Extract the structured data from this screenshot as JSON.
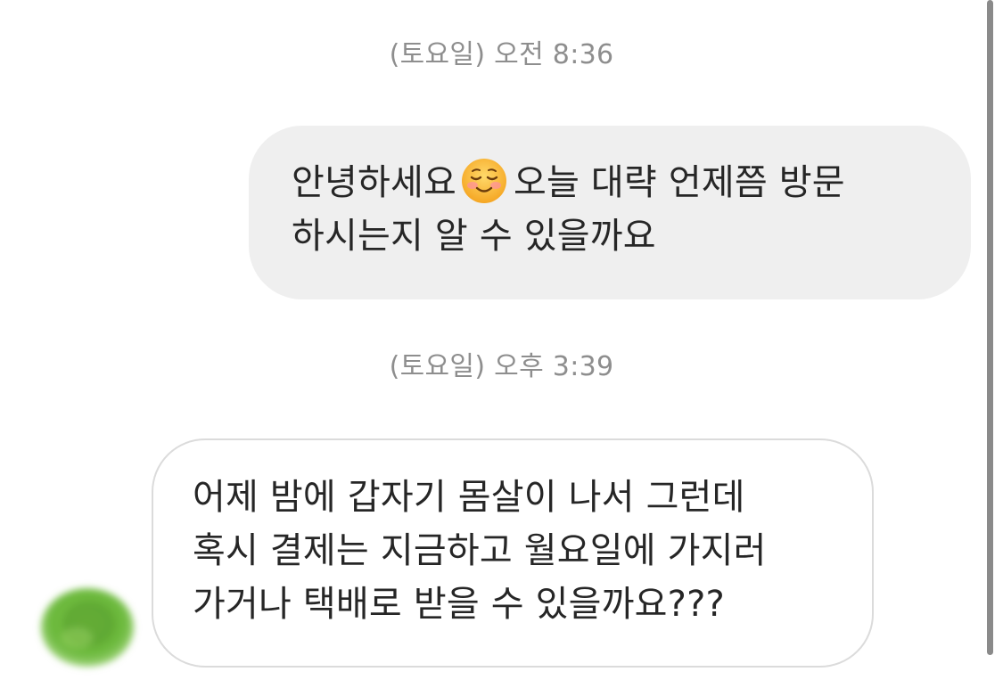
{
  "conversation": {
    "timestamps": [
      "(토요일) 오전 8:36",
      "(토요일) 오후 3:39"
    ],
    "messages": [
      {
        "direction": "outgoing",
        "lines": [
          [
            "안녕하세요",
            "오늘 대략 언제쯤 방문"
          ],
          "하시는지 알 수 있을까요"
        ],
        "emoji": "smiling-face-with-smiling-eyes-emoji"
      },
      {
        "direction": "incoming",
        "lines": [
          "어제 밤에 갑자기 몸살이 나서 그런데",
          "혹시 결제는 지금하고 월요일에 가지러",
          "가거나 택배로 받을 수 있을까요???"
        ]
      }
    ],
    "avatar": {
      "icon": "green-blurred-avatar"
    }
  },
  "colors": {
    "background": "#ffffff",
    "timestamp_text": "#8e8e8e",
    "outgoing_bubble": "#efefef",
    "incoming_border": "#dbdbdb",
    "message_text": "#262626",
    "scrollbar": "#8a8a8a"
  }
}
